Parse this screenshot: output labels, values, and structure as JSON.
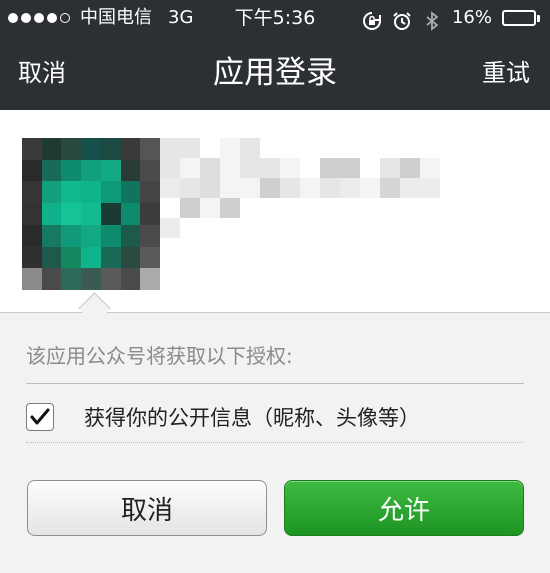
{
  "status_bar": {
    "carrier": "中国电信",
    "network": "3G",
    "time": "下午5:36",
    "battery": "16%",
    "battery_level": 0.16
  },
  "nav": {
    "left": "取消",
    "title": "应用登录",
    "right": "重试"
  },
  "permissions": {
    "title": "该应用公众号将获取以下授权:",
    "items": [
      {
        "label": "获得你的公开信息（昵称、头像等）",
        "checked": true
      }
    ]
  },
  "buttons": {
    "cancel": "取消",
    "allow": "允许"
  },
  "colors": {
    "nav_bg": "#2c2f33",
    "allow_green": "#1d9422",
    "battery_red": "#e0352b"
  }
}
